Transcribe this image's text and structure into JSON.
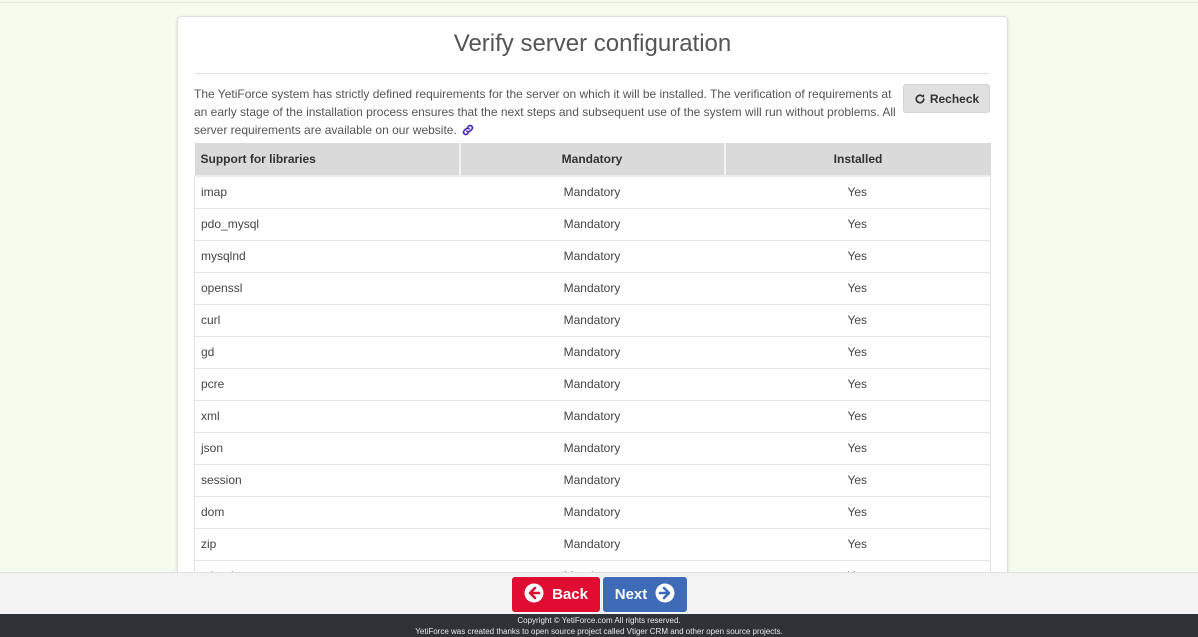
{
  "page": {
    "title": "Verify server configuration",
    "intro_text": "The YetiForce system has strictly defined requirements for the server on which it will be installed. The verification of requirements at an early stage of the installation process ensures that the next steps and subsequent use of the system will run without problems. All server requirements are available on our website.",
    "link_icon": "link-icon",
    "recheck_label": "Recheck",
    "recheck_icon": "redo-icon"
  },
  "table": {
    "headers": [
      "Support for libraries",
      "Mandatory",
      "Installed"
    ],
    "rows": [
      {
        "name": "imap",
        "mandatory": "Mandatory",
        "installed": "Yes"
      },
      {
        "name": "pdo_mysql",
        "mandatory": "Mandatory",
        "installed": "Yes"
      },
      {
        "name": "mysqlnd",
        "mandatory": "Mandatory",
        "installed": "Yes"
      },
      {
        "name": "openssl",
        "mandatory": "Mandatory",
        "installed": "Yes"
      },
      {
        "name": "curl",
        "mandatory": "Mandatory",
        "installed": "Yes"
      },
      {
        "name": "gd",
        "mandatory": "Mandatory",
        "installed": "Yes"
      },
      {
        "name": "pcre",
        "mandatory": "Mandatory",
        "installed": "Yes"
      },
      {
        "name": "xml",
        "mandatory": "Mandatory",
        "installed": "Yes"
      },
      {
        "name": "json",
        "mandatory": "Mandatory",
        "installed": "Yes"
      },
      {
        "name": "session",
        "mandatory": "Mandatory",
        "installed": "Yes"
      },
      {
        "name": "dom",
        "mandatory": "Mandatory",
        "installed": "Yes"
      },
      {
        "name": "zip",
        "mandatory": "Mandatory",
        "installed": "Yes"
      },
      {
        "name": "mbstring",
        "mandatory": "Mandatory",
        "installed": "Yes"
      }
    ]
  },
  "nav": {
    "back_label": "Back",
    "next_label": "Next"
  },
  "footer": {
    "line1": "Copyright © YetiForce.com All rights reserved.",
    "line2": "YetiForce was created thanks to open source project called Vtiger CRM and other open source projects."
  },
  "colors": {
    "back": "#df0d31",
    "next": "#3e6bb8",
    "background": "#f4fcee",
    "footer": "#2f3338"
  }
}
